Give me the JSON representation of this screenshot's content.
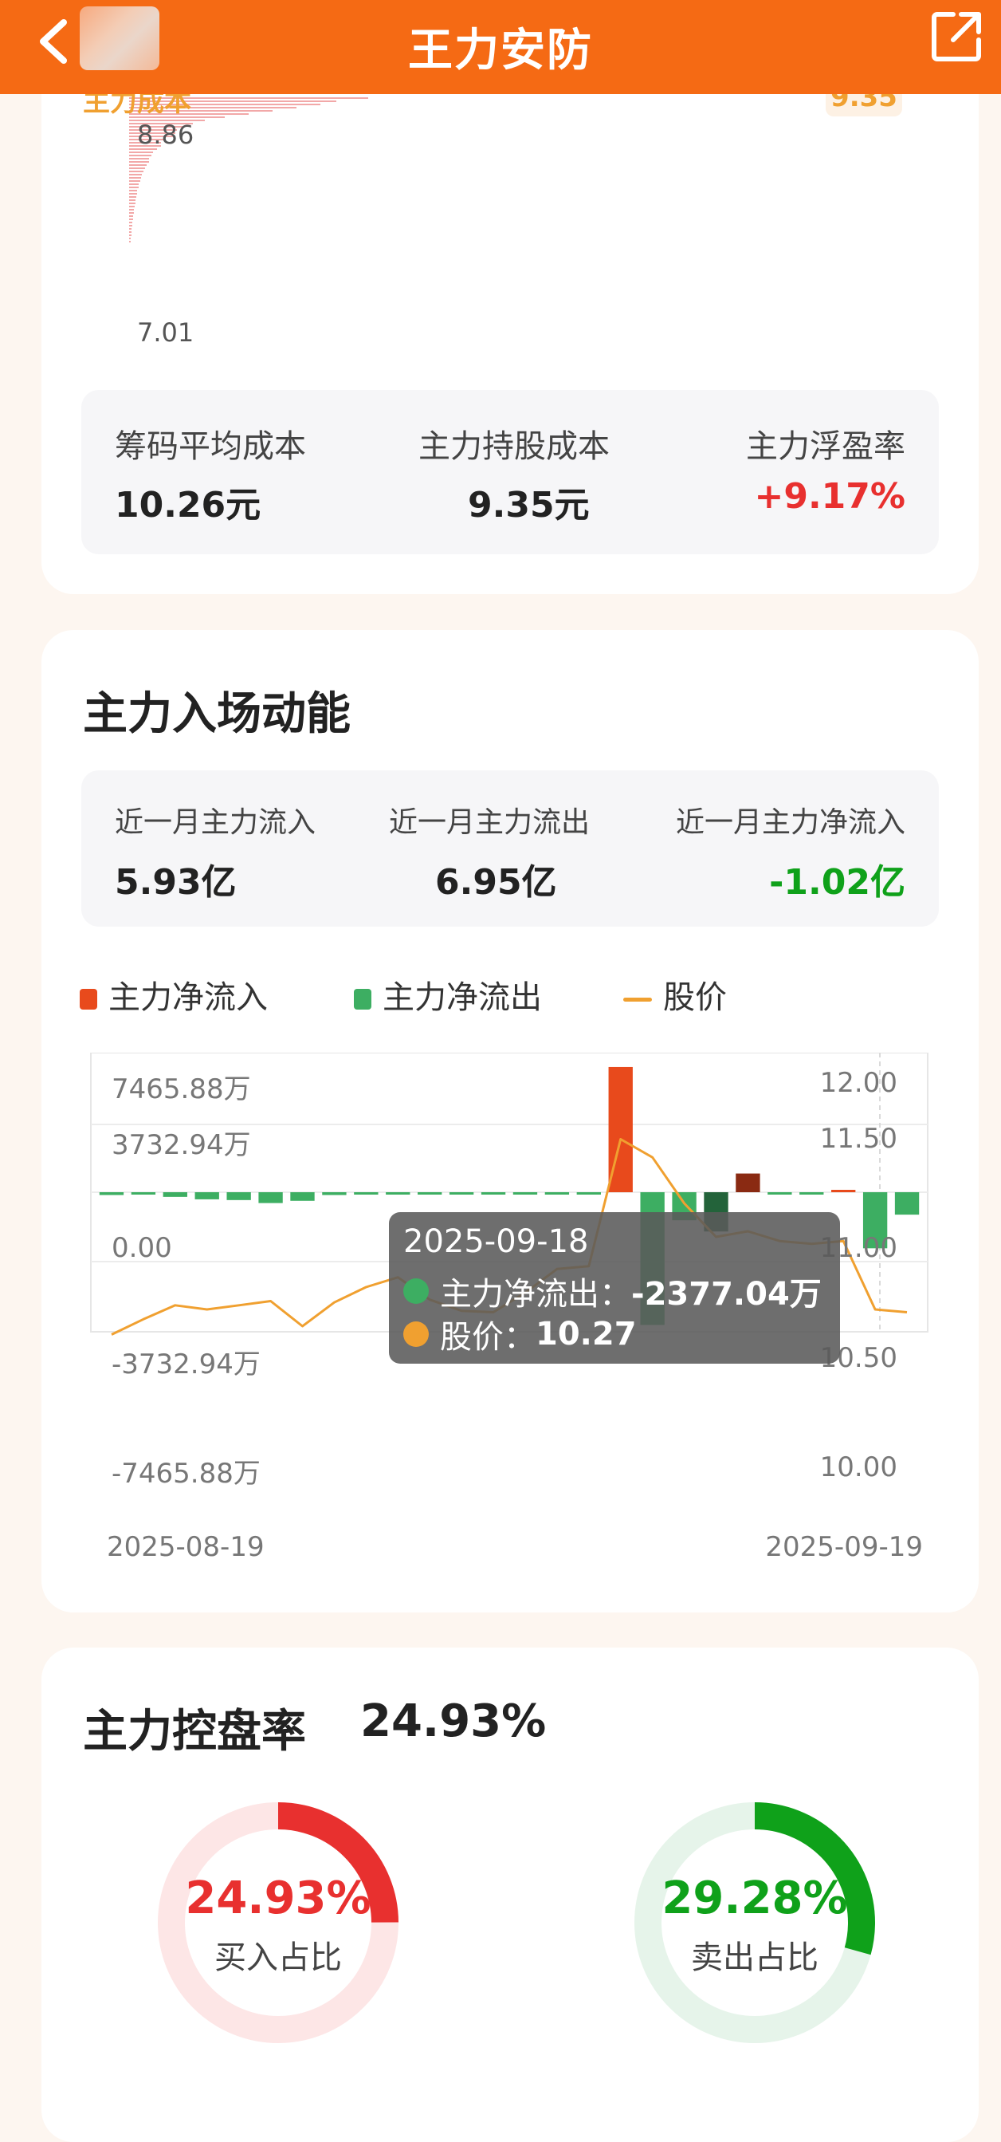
{
  "header": {
    "title": "王力安防"
  },
  "chip_section": {
    "main_cost_label": "主力成本",
    "main_cost_tag": "9.35",
    "price_top": "8.86",
    "price_bottom": "7.01",
    "stats": [
      {
        "label": "筹码平均成本",
        "value": "10.26元"
      },
      {
        "label": "主力持股成本",
        "value": "9.35元"
      },
      {
        "label": "主力浮盈率",
        "value": "+9.17%"
      }
    ]
  },
  "flow_section": {
    "title": "主力入场动能",
    "stats": [
      {
        "label": "近一月主力流入",
        "value": "5.93亿"
      },
      {
        "label": "近一月主力流出",
        "value": "6.95亿"
      },
      {
        "label": "近一月主力净流入",
        "value": "-1.02亿"
      }
    ],
    "legend": [
      {
        "label": "主力净流入",
        "color": "#e84a1c"
      },
      {
        "label": "主力净流出",
        "color": "#3dae62"
      },
      {
        "label": "股价",
        "color": "#f0a030"
      }
    ],
    "tooltip": {
      "date": "2025-09-18",
      "flow_label": "主力净流出：",
      "flow_value": "-2377.04万",
      "price_label": "股价：",
      "price_value": "10.27"
    }
  },
  "chart_data": {
    "type": "bar",
    "x_start_label": "2025-08-19",
    "x_end_label": "2025-09-19",
    "left_axis_ticks": [
      "7465.88万",
      "3732.94万",
      "0.00",
      "-3732.94万",
      "-7465.88万"
    ],
    "right_axis_ticks": [
      "12.00",
      "11.50",
      "11.00",
      "10.50",
      "10.00"
    ],
    "ylim_flow": [
      -7465.88,
      7465.88
    ],
    "ylim_price": [
      10.0,
      12.0
    ],
    "series": [
      {
        "name": "主力净流入/主力净流出",
        "unit": "万",
        "values": [
          -150,
          -50,
          -250,
          -380,
          -420,
          -580,
          -460,
          -150,
          -60,
          -50,
          -30,
          -20,
          -40,
          -60,
          -50,
          -20,
          6700,
          -7100,
          -1500,
          -2100,
          1000,
          -30,
          -60,
          60,
          -3000,
          -1200
        ]
      },
      {
        "name": "股价",
        "values": [
          9.98,
          10.09,
          10.19,
          10.16,
          10.19,
          10.22,
          10.04,
          10.21,
          10.32,
          10.39,
          10.23,
          10.15,
          10.14,
          10.28,
          10.45,
          10.47,
          11.38,
          11.25,
          10.92,
          10.68,
          10.72,
          10.65,
          10.63,
          10.65,
          10.16,
          10.14
        ]
      }
    ]
  },
  "control_section": {
    "title": "主力控盘率",
    "value": "24.93%",
    "buy": {
      "pct": "24.93%",
      "label": "买入占比",
      "fraction": 0.2493,
      "color": "#e8302f",
      "track": "#fde6e6"
    },
    "sell": {
      "pct": "29.28%",
      "label": "卖出占比",
      "fraction": 0.2928,
      "color": "#0fa11a",
      "track": "#e6f4ea"
    }
  }
}
